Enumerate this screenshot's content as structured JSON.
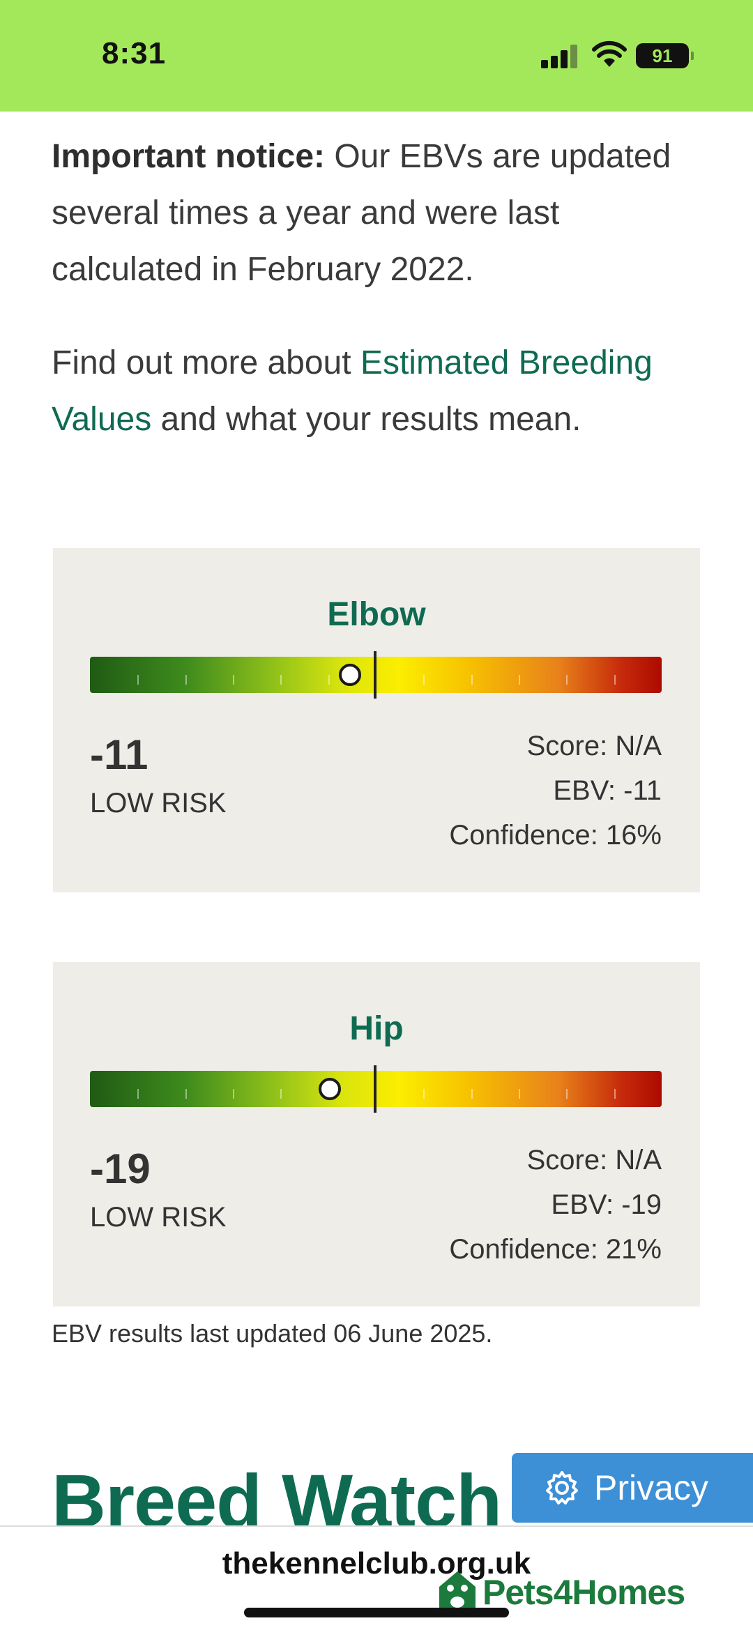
{
  "status_bar": {
    "time": "8:31",
    "battery": "91",
    "background": "#a3e85a"
  },
  "notice": {
    "bold": "Important notice:",
    "text": " Our EBVs are updated several times a year and were last calculated in February 2022."
  },
  "more": {
    "prefix": "Find out more about ",
    "link": "Estimated Breeding Values",
    "suffix": " and what your results mean."
  },
  "cards": [
    {
      "title": "Elbow",
      "value": "-11",
      "risk": "LOW RISK",
      "score": "Score: N/A",
      "ebv": "EBV: -11",
      "confidence": "Confidence: 16%",
      "marker_fraction": 0.455
    },
    {
      "title": "Hip",
      "value": "-19",
      "risk": "LOW RISK",
      "score": "Score: N/A",
      "ebv": "EBV: -19",
      "confidence": "Confidence: 21%",
      "marker_fraction": 0.42
    }
  ],
  "updated": "EBV results last updated 06 June 2025.",
  "breed_watch": "Breed Watch",
  "privacy": {
    "label": "Privacy",
    "icon": "gear-icon"
  },
  "url": "thekennelclub.org.uk",
  "watermark": "Pets4Homes",
  "colors": {
    "link": "#0f6a52",
    "card_bg": "#efede8",
    "privacy": "#3d8fd6"
  }
}
